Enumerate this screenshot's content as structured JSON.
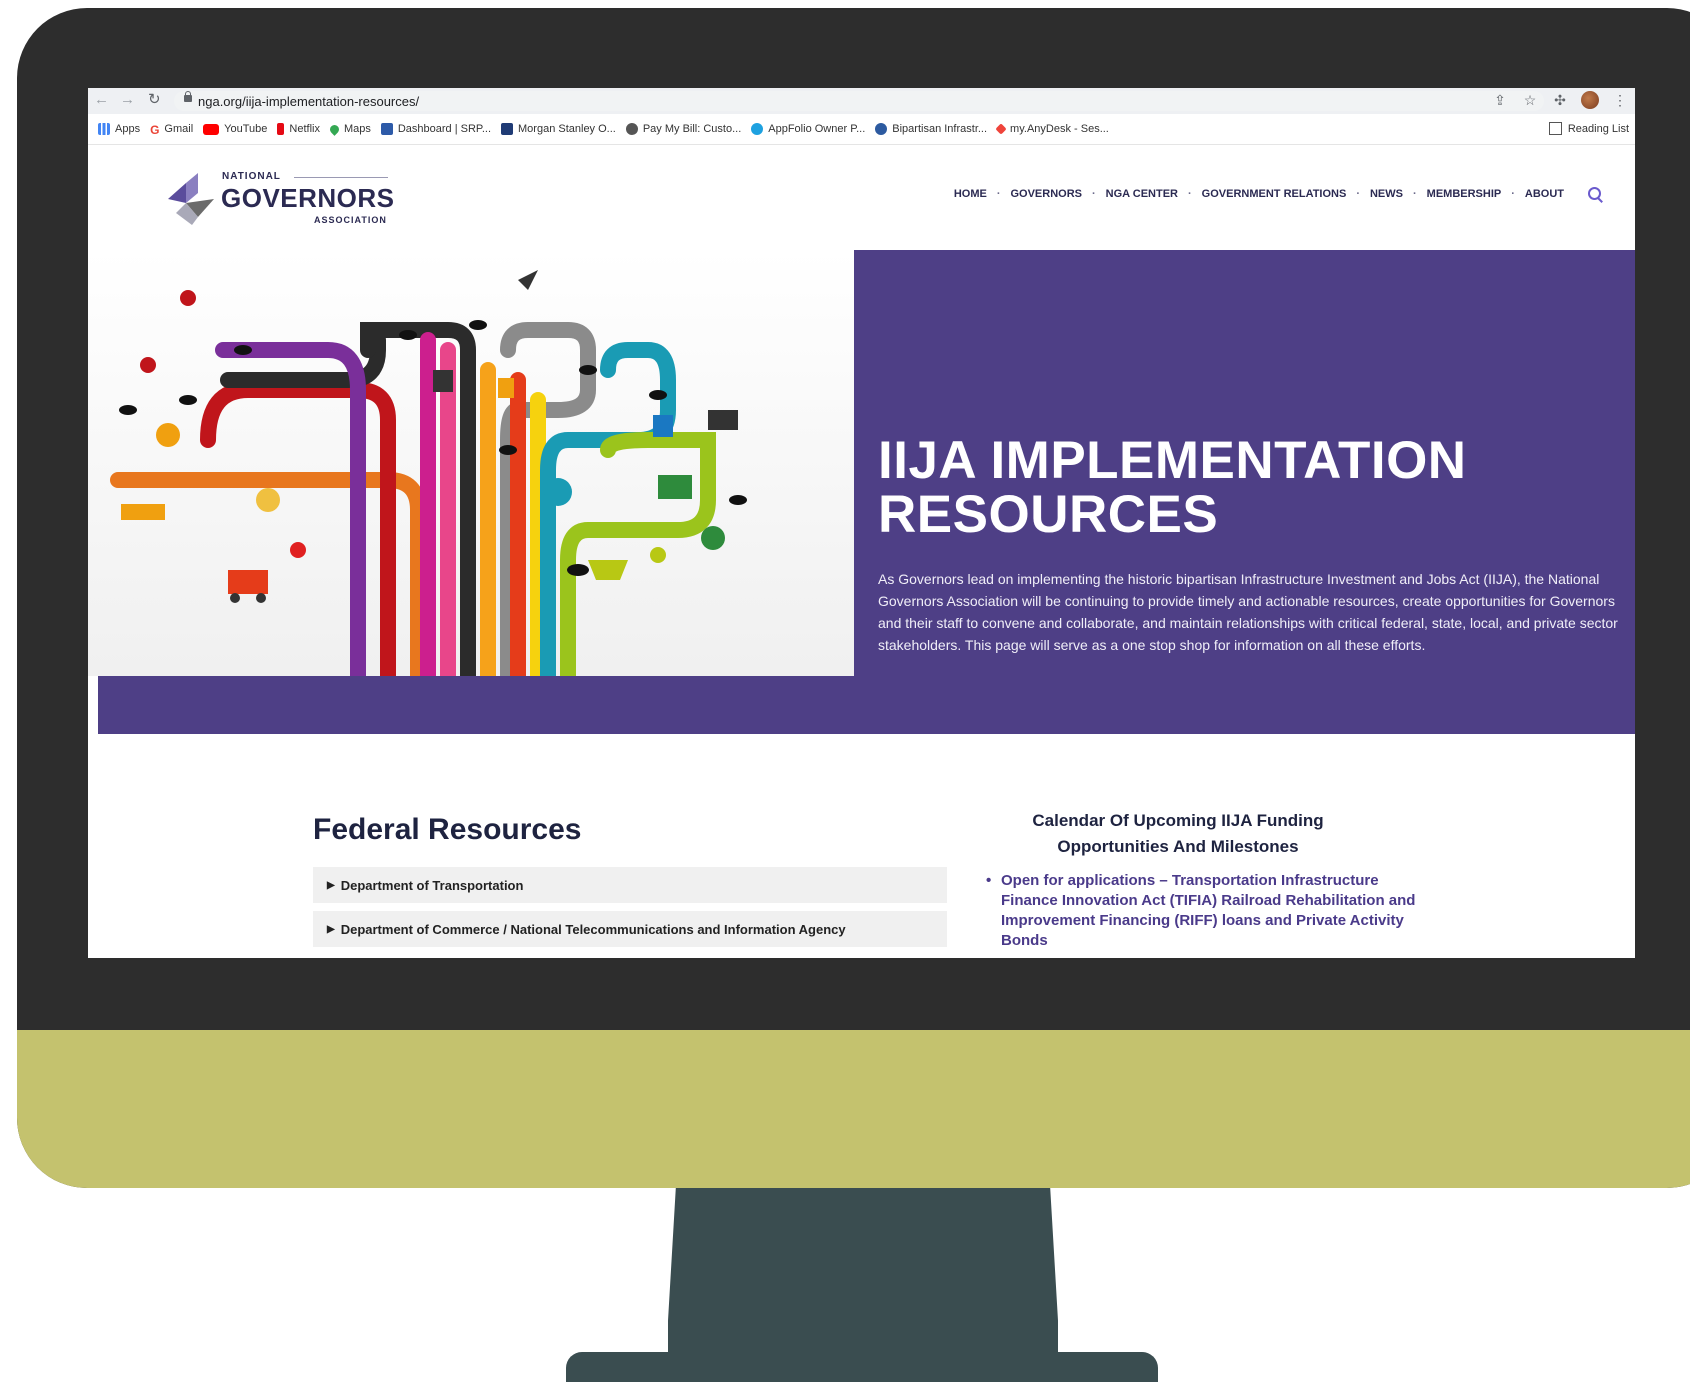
{
  "browser": {
    "url": "nga.org/iija-implementation-resources/",
    "bookmarks": [
      {
        "label": "Apps",
        "icon": "apps-grid-icon",
        "color": "#4285f4"
      },
      {
        "label": "Gmail",
        "icon": "google-icon",
        "color": "#ea4335"
      },
      {
        "label": "YouTube",
        "icon": "youtube-icon",
        "color": "#ff0000"
      },
      {
        "label": "Netflix",
        "icon": "netflix-icon",
        "color": "#e50914"
      },
      {
        "label": "Maps",
        "icon": "maps-pin-icon",
        "color": "#34a853"
      },
      {
        "label": "Dashboard | SRP...",
        "icon": "dashboard-icon",
        "color": "#2d5aa8"
      },
      {
        "label": "Morgan Stanley O...",
        "icon": "morgan-stanley-icon",
        "color": "#1f3b75"
      },
      {
        "label": "Pay My Bill: Custo...",
        "icon": "globe-icon",
        "color": "#555555"
      },
      {
        "label": "AppFolio Owner P...",
        "icon": "appfolio-icon",
        "color": "#1ea1e0"
      },
      {
        "label": "Bipartisan Infrastr...",
        "icon": "bipartisan-icon",
        "color": "#2c5aa0"
      },
      {
        "label": "my.AnyDesk - Ses...",
        "icon": "anydesk-icon",
        "color": "#ef443b"
      }
    ],
    "reading_list": "Reading List"
  },
  "site": {
    "logo": {
      "national": "NATIONAL",
      "governors": "GOVERNORS",
      "association": "ASSOCIATION"
    },
    "nav": [
      "HOME",
      "GOVERNORS",
      "NGA CENTER",
      "GOVERNMENT RELATIONS",
      "NEWS",
      "MEMBERSHIP",
      "ABOUT"
    ],
    "nav_separator": "·"
  },
  "hero": {
    "title": "IIJA IMPLEMENTATION RESOURCES",
    "description": "As Governors lead on implementing the historic bipartisan Infrastructure Investment and Jobs Act (IIJA), the National Governors Association will be continuing to provide timely and actionable resources, create opportunities for Governors and their staff to convene and collaborate, and maintain relationships with critical federal, state, local, and private sector stakeholders. This page will serve as a one stop shop for information on all these efforts."
  },
  "federal_resources": {
    "title": "Federal Resources",
    "items": [
      "Department of Transportation",
      "Department of Commerce / National Telecommunications and Information Agency"
    ]
  },
  "calendar": {
    "title": "Calendar Of Upcoming IIJA Funding Opportunities And Milestones",
    "items": [
      "Open for applications – Transportation Infrastructure Finance Innovation Act (TIFIA) Railroad Rehabilitation and Improvement Financing (RIFF) loans and Private Activity Bonds"
    ]
  },
  "colors": {
    "brand_purple": "#4e3f86",
    "bezel": "#2d2d2d",
    "chin": "#c4c26e",
    "stand": "#3a4d50"
  }
}
